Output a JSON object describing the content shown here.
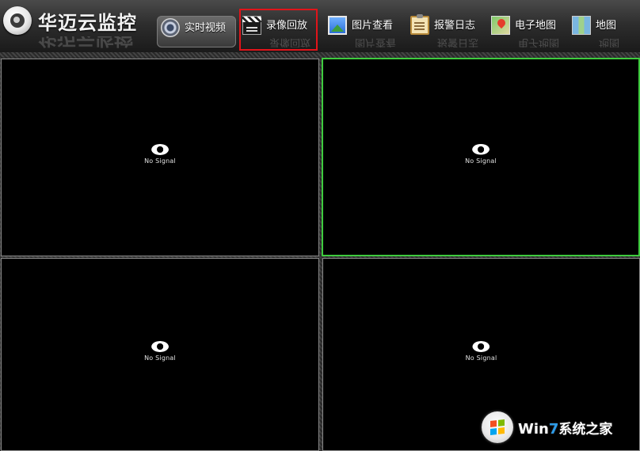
{
  "app": {
    "title": "华迈云监控"
  },
  "nav": {
    "items": [
      {
        "id": "live",
        "label": "实时视频",
        "icon": "camera-icon"
      },
      {
        "id": "record",
        "label": "录像回放",
        "icon": "clapperboard-icon"
      },
      {
        "id": "photos",
        "label": "图片查看",
        "icon": "photo-icon"
      },
      {
        "id": "alarm",
        "label": "报警日志",
        "icon": "clipboard-icon"
      },
      {
        "id": "emap",
        "label": "电子地图",
        "icon": "map-pin-icon"
      },
      {
        "id": "map",
        "label": "地图",
        "icon": "map-icon"
      }
    ],
    "highlighted": "record",
    "highlight_color": "#e1141a"
  },
  "grid": {
    "panes": [
      {
        "status": "No Signal",
        "active": false
      },
      {
        "status": "No Signal",
        "active": true
      },
      {
        "status": "No Signal",
        "active": false
      },
      {
        "status": "No Signal",
        "active": false
      }
    ],
    "active_border_color": "#3ecb3e"
  },
  "watermark": {
    "brand_prefix": "Wi",
    "brand_n": "n",
    "brand_seven": "7",
    "brand_suffix": "系统之家"
  }
}
